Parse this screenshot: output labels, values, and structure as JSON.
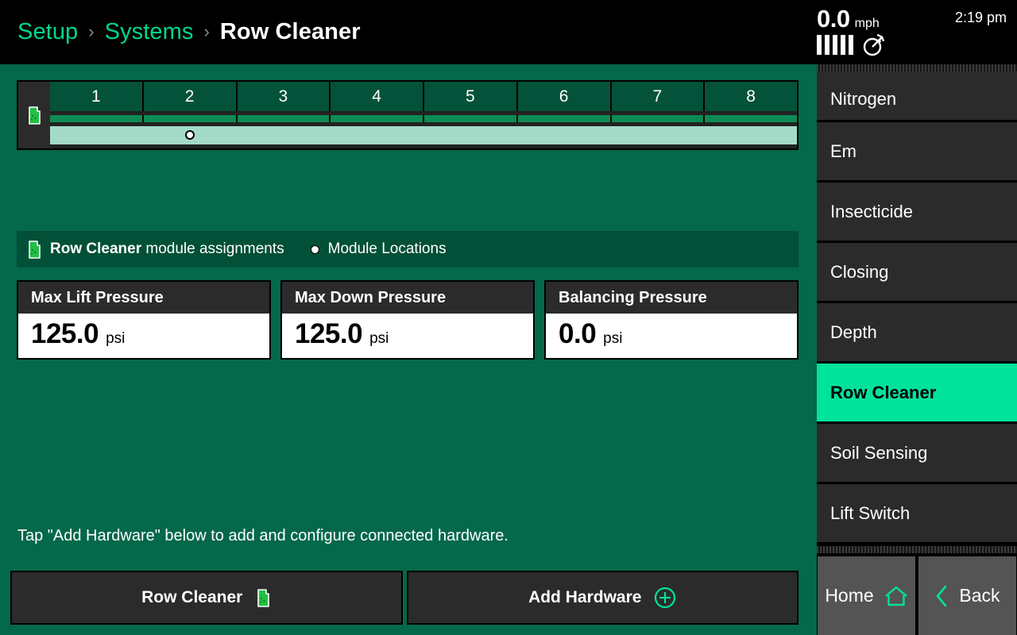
{
  "breadcrumb": {
    "items": [
      {
        "label": "Setup",
        "current": false
      },
      {
        "label": "Systems",
        "current": false
      },
      {
        "label": "Row Cleaner",
        "current": true
      }
    ],
    "separator": "›"
  },
  "status": {
    "speed_value": "0.0",
    "speed_unit": "mph",
    "time": "2:19 pm",
    "signal_bars": 5,
    "gps_icon": "satellite-dish-icon"
  },
  "row_diagram": {
    "module_icon": "row-cleaner-module-icon",
    "row_labels": [
      "1",
      "2",
      "3",
      "4",
      "5",
      "6",
      "7",
      "8"
    ],
    "marker_row": 2,
    "marker_position_percent": 18.7,
    "colors": {
      "header_cell": "#04523a",
      "green_band": "#0e8a55",
      "mint_band": "#a3dac8",
      "separator": "#222222"
    }
  },
  "legend": {
    "module_icon": "row-cleaner-module-icon",
    "assignment_bold": "Row Cleaner",
    "assignment_rest": " module assignments",
    "locations_label": "Module Locations",
    "location_dot_icon": "filled-circle-icon"
  },
  "cards": [
    {
      "title": "Max Lift Pressure",
      "value": "125.0",
      "unit": "psi"
    },
    {
      "title": "Max Down Pressure",
      "value": "125.0",
      "unit": "psi"
    },
    {
      "title": "Balancing Pressure",
      "value": "0.0",
      "unit": "psi"
    }
  ],
  "hint": "Tap \"Add Hardware\" below to add and configure connected hardware.",
  "action_bar": {
    "row_cleaner_label": "Row Cleaner",
    "row_cleaner_icon": "row-cleaner-module-icon",
    "add_hardware_label": "Add Hardware",
    "add_hardware_icon": "plus-circle-icon"
  },
  "sidebar": {
    "items": [
      {
        "label": "Nitrogen",
        "active": false,
        "clipped": true
      },
      {
        "label": "Em",
        "active": false,
        "clipped": false
      },
      {
        "label": "Insecticide",
        "active": false,
        "clipped": false
      },
      {
        "label": "Closing",
        "active": false,
        "clipped": false
      },
      {
        "label": "Depth",
        "active": false,
        "clipped": false
      },
      {
        "label": "Row Cleaner",
        "active": true,
        "clipped": false
      },
      {
        "label": "Soil Sensing",
        "active": false,
        "clipped": false
      },
      {
        "label": "Lift Switch",
        "active": false,
        "clipped": false
      }
    ],
    "active_color": "#00e39b"
  },
  "nav": {
    "home_label": "Home",
    "home_icon": "house-icon",
    "back_label": "Back",
    "back_icon": "chevron-left-icon"
  }
}
